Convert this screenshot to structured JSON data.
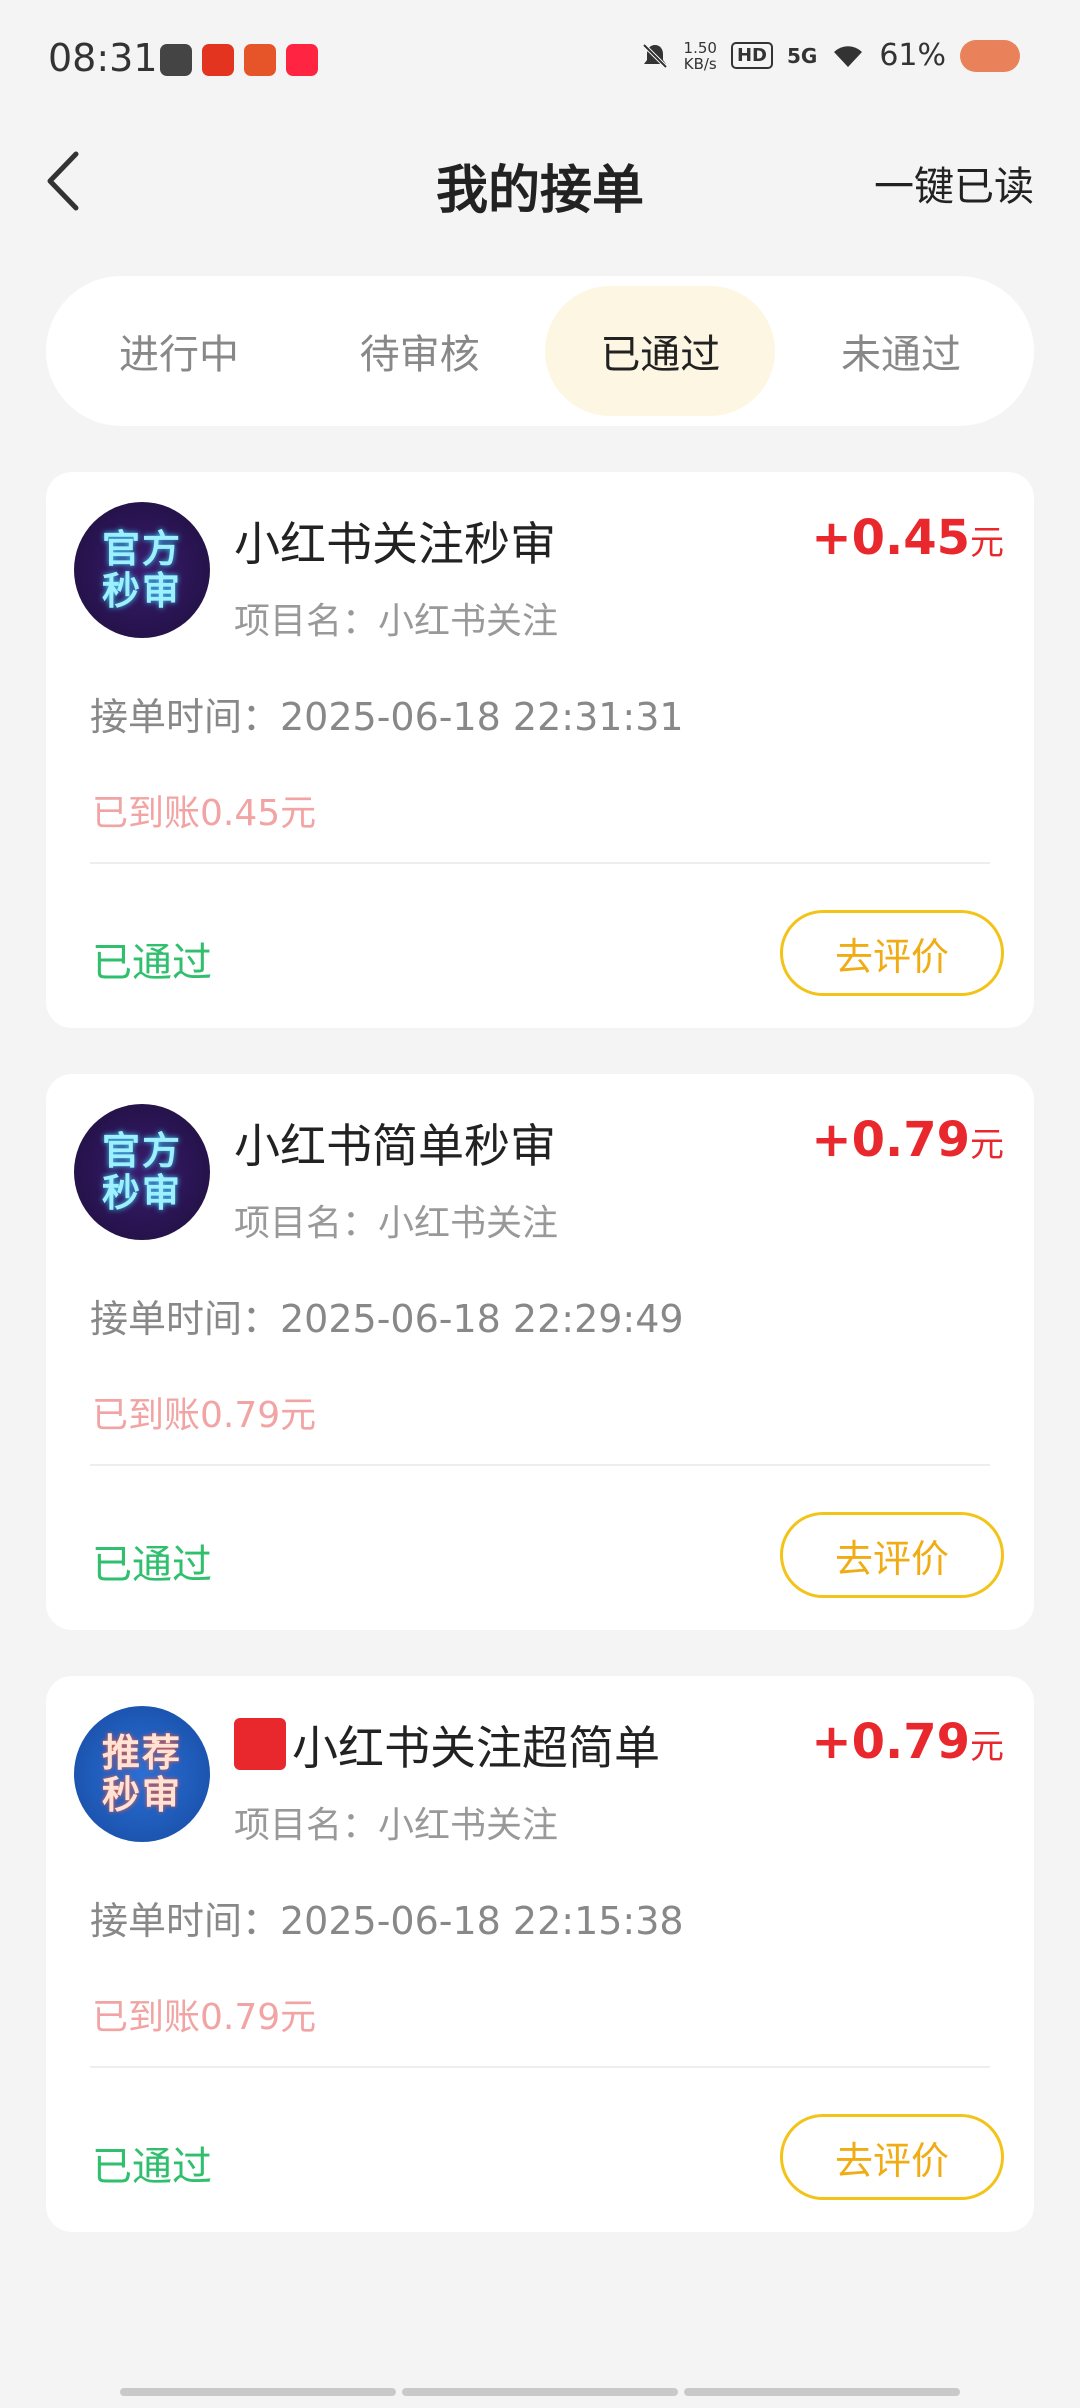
{
  "status_bar": {
    "time": "08:31",
    "net_speed_value": "1.50",
    "net_speed_unit": "KB/s",
    "hd": "HD",
    "network": "5G",
    "battery": "61%"
  },
  "header": {
    "title": "我的接单",
    "read_all": "一键已读"
  },
  "tabs": [
    {
      "label": "进行中"
    },
    {
      "label": "待审核"
    },
    {
      "label": "已通过"
    },
    {
      "label": "未通过"
    }
  ],
  "cards": [
    {
      "avatar_line1": "官方",
      "avatar_line2": "秒审",
      "name": "小红书关注秒审",
      "project": "项目名：小红书关注",
      "amount": "+0.45",
      "amount_unit": "元",
      "accept_time": "接单时间：2025-06-18 22:31:31",
      "arrived": "已到账0.45元",
      "status": "已通过",
      "button": "去评价"
    },
    {
      "avatar_line1": "官方",
      "avatar_line2": "秒审",
      "name": "小红书简单秒审",
      "project": "项目名：小红书关注",
      "amount": "+0.79",
      "amount_unit": "元",
      "accept_time": "接单时间：2025-06-18 22:29:49",
      "arrived": "已到账0.79元",
      "status": "已通过",
      "button": "去评价"
    },
    {
      "avatar_line1": "推荐",
      "avatar_line2": "秒审",
      "name": "小红书关注超简单",
      "project": "项目名：小红书关注",
      "amount": "+0.79",
      "amount_unit": "元",
      "accept_time": "接单时间：2025-06-18 22:15:38",
      "arrived": "已到账0.79元",
      "status": "已通过",
      "button": "去评价"
    }
  ],
  "colors": {
    "amount": "#e8282d",
    "pass": "#2fbf6d",
    "button_border": "#f3c318",
    "active_tab_bg": "#fdf6e2"
  }
}
